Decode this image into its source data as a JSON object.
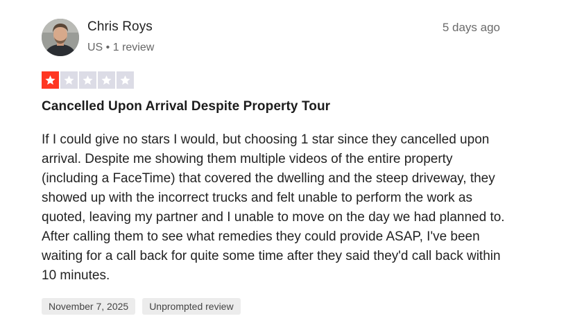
{
  "reviewer": {
    "name": "Chris Roys",
    "meta": "US • 1 review",
    "avatar_icon": "person-avatar"
  },
  "review": {
    "relative_date": "5 days ago",
    "rating": 1,
    "max_rating": 5,
    "star_filled_color": "#ff3722",
    "star_empty_color": "#dcdce6",
    "title": "Cancelled Upon Arrival Despite Property Tour",
    "body": "If I could give no stars I would, but choosing 1 star since they cancelled upon arrival. Despite me showing them multiple videos of the entire property (including a FaceTime) that covered the dwelling and the steep driveway, they showed up with the incorrect trucks and felt unable to perform the work as quoted, leaving my partner and I unable to move on the day we had planned to. After calling them to see what remedies they could provide ASAP, I've been waiting for a call back for quite some time after they said they'd call back within 10 minutes.",
    "date_tag": "November 7, 2025",
    "type_tag": "Unprompted review"
  }
}
